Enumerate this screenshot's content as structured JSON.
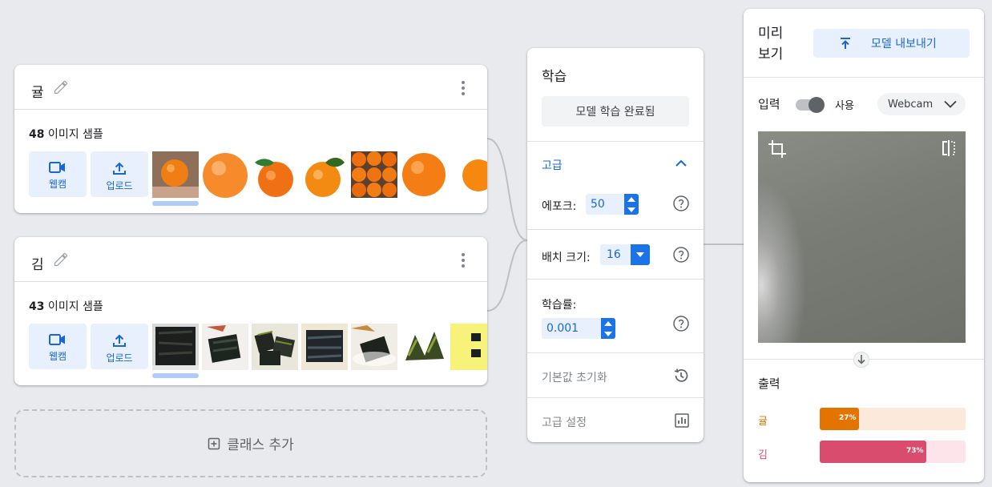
{
  "classes": [
    {
      "name": "귤",
      "count_num": "48",
      "count_text": " 이미지 샘플",
      "webcam_label": "웹캠",
      "upload_label": "업로드"
    },
    {
      "name": "김",
      "count_num": "43",
      "count_text": " 이미지 샘플",
      "webcam_label": "웹캠",
      "upload_label": "업로드"
    }
  ],
  "add_class_label": "클래스 추가",
  "training": {
    "title": "학습",
    "train_button": "모델 학습 완료됨",
    "advanced_label": "고급",
    "epochs_label": "에포크:",
    "epochs_value": "50",
    "batch_label": "배치 크기:",
    "batch_value": "16",
    "lr_label": "학습률:",
    "lr_value": "0.001",
    "reset_label": "기본값 초기화",
    "advanced_settings_label": "고급 설정"
  },
  "preview": {
    "title": "미리보기",
    "export_button": "모델 내보내기",
    "input_label": "입력",
    "toggle_label": "사용",
    "input_source": "Webcam",
    "output_label": "출력",
    "outputs": [
      {
        "name": "귤",
        "percent_label": "27%",
        "value": 27,
        "color": "#e37400",
        "bg": "#fde8dc"
      },
      {
        "name": "김",
        "percent_label": "73%",
        "value": 73,
        "color": "#d94c6e",
        "bg": "#fce4ea"
      }
    ]
  },
  "colors": {
    "accent": "#1a73e8",
    "accent_text": "#1967d2",
    "accent_bg": "#e8f0fe"
  }
}
